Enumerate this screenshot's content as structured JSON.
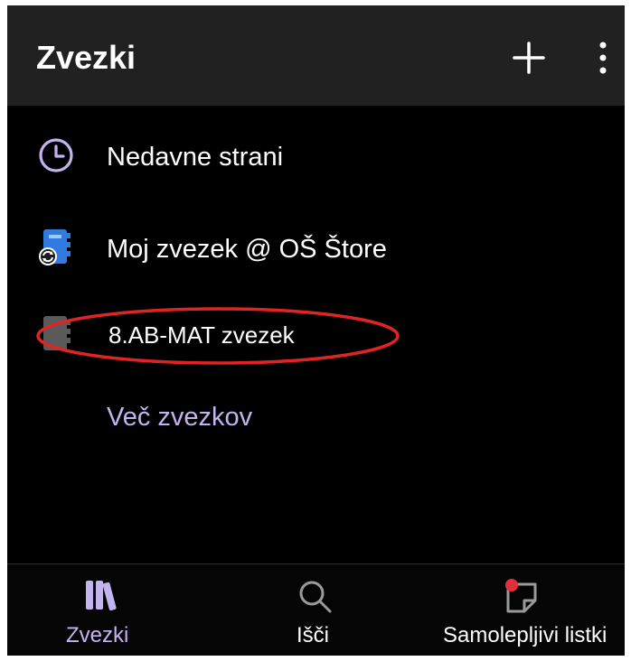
{
  "header": {
    "title": "Zvezki",
    "add_icon": "plus-icon",
    "more_icon": "more-vertical-icon"
  },
  "list": {
    "items": [
      {
        "label": "Nedavne strani",
        "icon": "clock-icon"
      },
      {
        "label": "Moj zvezek @ OŠ Štore",
        "icon": "notebook-sync-icon"
      },
      {
        "label": "8.AB-MAT zvezek",
        "icon": "notebook-gray-icon",
        "highlighted": true
      }
    ],
    "more_label": "Več zvezkov"
  },
  "bottom_nav": {
    "tabs": [
      {
        "label": "Zvezki",
        "icon": "notebooks-icon",
        "active": true
      },
      {
        "label": "Išči",
        "icon": "search-icon",
        "active": false
      },
      {
        "label": "Samolepljivi listki",
        "icon": "sticky-note-icon",
        "active": false
      }
    ]
  },
  "colors": {
    "background": "#000000",
    "header": "#212121",
    "accent": "#c3b4ef",
    "annotation": "#e02424",
    "notification_dot": "#e0303a"
  }
}
